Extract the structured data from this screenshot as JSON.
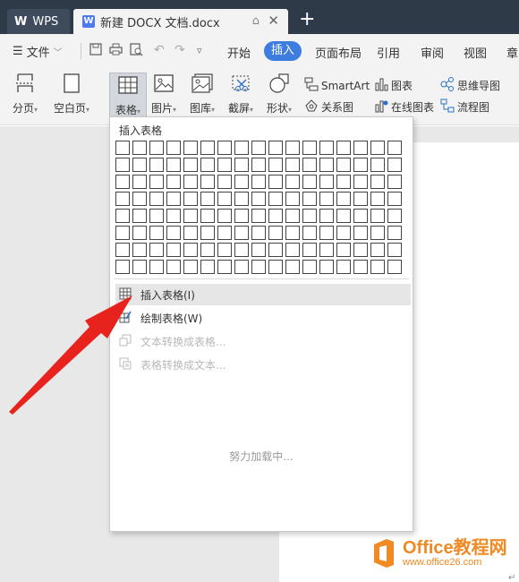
{
  "titlebar": {
    "app_tab": "WPS",
    "doc_tab": "新建 DOCX 文档.docx",
    "new_tab": "+"
  },
  "menubar": {
    "file": "文件",
    "items": [
      "开始",
      "插入",
      "页面布局",
      "引用",
      "审阅",
      "视图",
      "章"
    ],
    "active": "插入"
  },
  "ribbon": {
    "page_break": "分页",
    "blank_page": "空白页",
    "table": "表格",
    "picture": "图片",
    "gallery": "图库",
    "screenshot": "截屏",
    "shape": "形状",
    "smartart": "SmartArt",
    "chart": "图表",
    "relation": "关系图",
    "online_chart": "在线图表",
    "mindmap": "思维导图",
    "flowchart": "流程图"
  },
  "dropdown": {
    "heading": "插入表格",
    "grid_cols": 17,
    "grid_rows": 8,
    "items": [
      {
        "label": "插入表格(I)",
        "enabled": true,
        "hover": true
      },
      {
        "label": "绘制表格(W)",
        "enabled": true,
        "hover": false
      },
      {
        "label": "文本转换成表格...",
        "enabled": false,
        "hover": false
      },
      {
        "label": "表格转换成文本...",
        "enabled": false,
        "hover": false
      }
    ],
    "loading": "努力加载中..."
  },
  "watermark": {
    "title": "Office教程网",
    "url": "www.office26.com"
  },
  "colors": {
    "accent": "#3d7de0",
    "titlebar": "#2f3a49",
    "arrow": "#e8231e",
    "watermark": "#f08a24"
  }
}
